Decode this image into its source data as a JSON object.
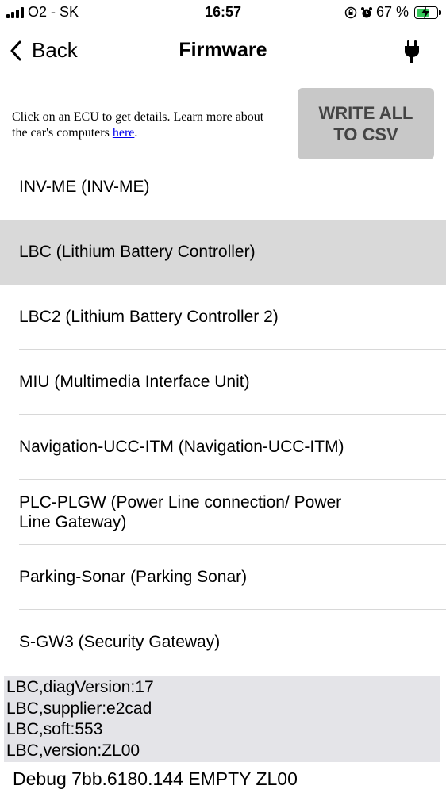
{
  "status_bar": {
    "carrier": "O2 - SK",
    "time": "16:57",
    "battery_percent": "67 %",
    "battery_level": 0.67,
    "icons": [
      "signal-icon",
      "screen-rotation-lock-icon",
      "alarm-icon",
      "battery-charging-icon"
    ]
  },
  "nav": {
    "back_label": "Back",
    "title": "Firmware",
    "right_icon": "plug-icon"
  },
  "intro": {
    "text": "Click on an ECU to get details. Learn more about the car's computers ",
    "link": "here",
    "suffix": "."
  },
  "csv_button": {
    "line1": "WRITE ALL",
    "line2": "TO CSV"
  },
  "ecus": [
    {
      "label": "INV-ME (INV-ME)"
    },
    {
      "label": "LBC (Lithium Battery Controller)",
      "selected": true
    },
    {
      "label": "LBC2 (Lithium Battery Controller 2)"
    },
    {
      "label": "MIU (Multimedia Interface Unit)"
    },
    {
      "label": "Navigation-UCC-ITM (Navigation-UCC-ITM)"
    },
    {
      "label": "PLC-PLGW (Power Line connection/ Power Line Gateway)"
    },
    {
      "label": "Parking-Sonar (Parking Sonar)"
    },
    {
      "label": "S-GW3 (Security Gateway)"
    }
  ],
  "details": [
    "LBC,diagVersion:17",
    "LBC,supplier:e2cad",
    "LBC,soft:553",
    "LBC,version:ZL00"
  ],
  "debug": "Debug 7bb.6180.144 EMPTY ZL00"
}
